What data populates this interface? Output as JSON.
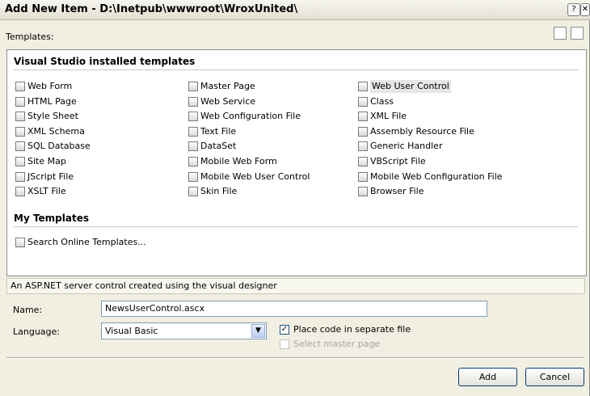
{
  "window": {
    "title": "Add New Item - D:\\Inetpub\\wwwroot\\WroxUnited\\"
  },
  "templates_label": "Templates:",
  "installed": {
    "header": "Visual Studio installed templates",
    "col1": [
      "Web Form",
      "HTML Page",
      "Style Sheet",
      "XML Schema",
      "SQL Database",
      "Site Map",
      "JScript File",
      "XSLT File"
    ],
    "col2": [
      "Master Page",
      "Web Service",
      "Web Configuration File",
      "Text File",
      "DataSet",
      "Mobile Web Form",
      "Mobile Web User Control",
      "Skin File"
    ],
    "col3": [
      "Web User Control",
      "Class",
      "XML File",
      "Assembly Resource File",
      "Generic Handler",
      "VBScript File",
      "Mobile Web Configuration File",
      "Browser File"
    ]
  },
  "my_templates": {
    "header": "My Templates",
    "search": "Search Online Templates..."
  },
  "description": "An ASP.NET server control created using the visual designer",
  "form": {
    "name_label": "Name:",
    "name_value": "NewsUserControl.ascx",
    "language_label": "Language:",
    "language_value": "Visual Basic",
    "place_code_label": "Place code in separate file",
    "place_code_checked": true,
    "master_label": "Select master page"
  },
  "buttons": {
    "add": "Add",
    "cancel": "Cancel"
  }
}
